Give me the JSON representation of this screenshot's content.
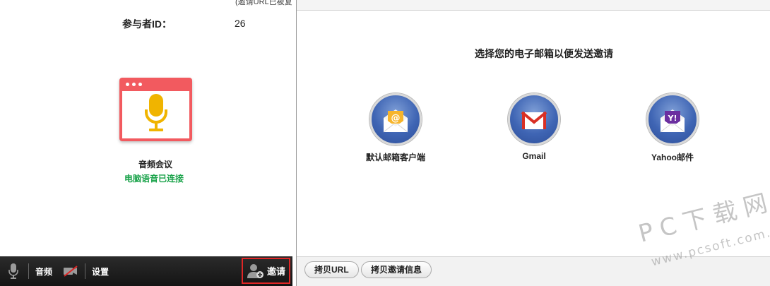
{
  "meeting": {
    "top_clipped_text": "(邀请URL已被复",
    "participant_id_label": "参与者ID：",
    "participant_id_value": "26",
    "audio_title": "音频会议",
    "audio_status": "电脑语音已连接"
  },
  "toolbar": {
    "audio_label": "音频",
    "settings_label": "设置",
    "invite_label": "邀请"
  },
  "invite_dialog": {
    "title": "选择您的电子邮箱以便发送邀请",
    "options": [
      {
        "label": "默认邮箱客户端",
        "icon": "default-mail-icon"
      },
      {
        "label": "Gmail",
        "icon": "gmail-icon"
      },
      {
        "label": "Yahoo邮件",
        "icon": "yahoo-mail-icon"
      }
    ],
    "copy_url_label": "拷贝URL",
    "copy_invite_label": "拷贝邀请信息"
  },
  "watermark": {
    "line1": "PC下载网",
    "line2": "www.pcsoft.com.cn"
  },
  "colors": {
    "audio_card": "#f25a5f",
    "mic": "#f0b400",
    "status_green": "#1aa34a",
    "invite_highlight": "#e02626",
    "option_circle": "#3f65b4"
  }
}
